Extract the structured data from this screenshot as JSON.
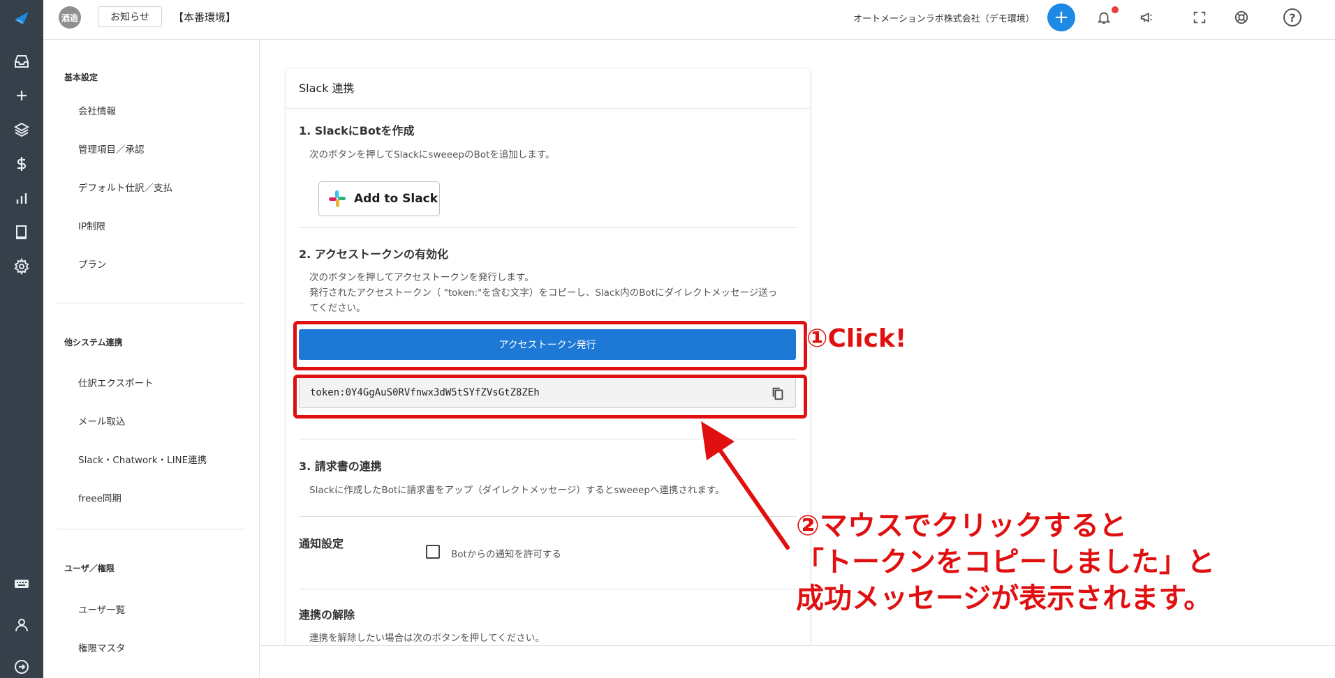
{
  "header": {
    "org_avatar": "酒造",
    "notice_button": "お知らせ",
    "environment": "【本番環境】",
    "company": "オートメーションラボ株式会社（デモ環境）",
    "plus": "+",
    "help": "?"
  },
  "rail_icons": [
    "logo-icon",
    "inbox-icon",
    "plus-icon",
    "layers-icon",
    "dollar-icon",
    "chart-icon",
    "book-icon",
    "gear-icon",
    "keyboard-icon",
    "user-icon",
    "logout-icon"
  ],
  "sidebar": {
    "sections": [
      {
        "title": "基本設定",
        "items": [
          "会社情報",
          "管理項目／承認",
          "デフォルト仕訳／支払",
          "IP制限",
          "プラン"
        ]
      },
      {
        "title": "他システム連携",
        "items": [
          "仕訳エクスポート",
          "メール取込",
          "Slack・Chatwork・LINE連携",
          "freee同期"
        ]
      },
      {
        "title": "ユーザ／権限",
        "items": [
          "ユーザ一覧",
          "権限マスタ"
        ]
      }
    ]
  },
  "card": {
    "title": "Slack 連携",
    "step1": {
      "title": "1. SlackにBotを作成",
      "text": "次のボタンを押してSlackにsweeepのBotを追加します。",
      "button": "Add to Slack"
    },
    "step2": {
      "title": "2. アクセストークンの有効化",
      "text1": "次のボタンを押してアクセストークンを発行します。",
      "text2": "発行されたアクセストークン（ \"token:\"を含む文字）をコピーし、Slack内のBotにダイレクトメッセージ送ってください。",
      "button": "アクセストークン発行",
      "token": "token:0Y4GgAuS0RVfnwx3dW5tSYfZVsGtZ8ZEh"
    },
    "step3": {
      "title": "3. 請求書の連携",
      "text": "Slackに作成したBotに請求書をアップ（ダイレクトメッセージ）するとsweeepへ連携されます。"
    },
    "notify": {
      "title": "通知設定",
      "checkbox_label": "Botからの通知を許可する"
    },
    "unlink": {
      "title": "連携の解除",
      "text": "連携を解除したい場合は次のボタンを押してください。"
    }
  },
  "annotations": {
    "click": "①Click!",
    "line1": "②マウスでクリックすると",
    "line2": "「トークンをコピーしました」と",
    "line3": "成功メッセージが表示されます。"
  },
  "colors": {
    "rail": "#35404a",
    "primary": "#1e78d6",
    "annotation": "#e01010"
  }
}
